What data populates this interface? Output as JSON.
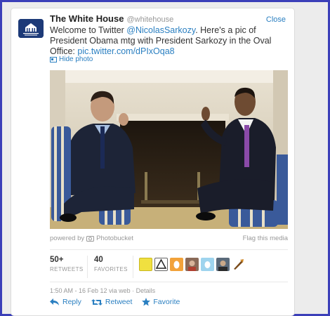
{
  "tweet": {
    "name": "The White House",
    "handle": "@whitehouse",
    "close_label": "Close",
    "text_before": "Welcome to Twitter ",
    "mention": "@NicolasSarkozy",
    "text_after": ". Here's a pic of President Obama mtg with President Sarkozy in the Oval Office: ",
    "link": "pic.twitter.com/dPIxOqa8",
    "hide_photo_label": "Hide photo"
  },
  "media": {
    "powered_by": "powered by",
    "provider": "Photobucket",
    "flag_label": "Flag this media"
  },
  "stats": {
    "retweets_count": "50+",
    "retweets_label": "RETWEETS",
    "favorites_count": "40",
    "favorites_label": "FAVORITES"
  },
  "meta": {
    "timestamp": "1:50 AM - 16 Feb 12",
    "via": "via web",
    "sep": "·",
    "details": "Details"
  },
  "actions": {
    "reply": "Reply",
    "retweet": "Retweet",
    "favorite": "Favorite"
  },
  "colors": {
    "frame": "#3b3fb8",
    "link": "#2a7fc1"
  }
}
